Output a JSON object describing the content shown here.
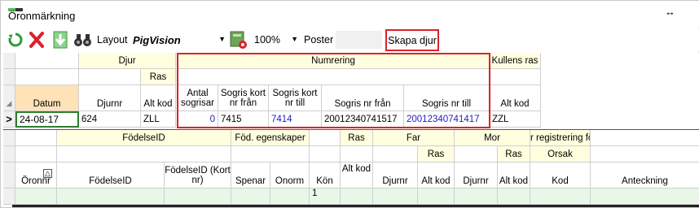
{
  "window": {
    "title": "Öronmärkning",
    "resize_icon": "↔"
  },
  "toolbar": {
    "layout_label": "Layout",
    "layout_value": "PigVision",
    "zoom_value": "100%",
    "poster_label": "Poster",
    "create_button": "Skapa djur"
  },
  "top_grid": {
    "groups": {
      "djur": "Djur",
      "ras": "Ras",
      "numrering": "Numrering",
      "kullens_ras": "Kullens ras"
    },
    "columns": {
      "datum": "Datum",
      "djurnr": "Djurnr",
      "alt_kod": "Alt kod",
      "antal_sogrisar": "Antal sogrisar",
      "sogris_kort_fran": "Sogris kort nr från",
      "sogris_kort_till": "Sogris kort nr till",
      "sogris_nr_fran": "Sogris nr från",
      "sogris_nr_till": "Sogris nr till",
      "kull_alt_kod": "Alt kod"
    },
    "row": {
      "indicator": ">",
      "datum": "24-08-17",
      "djurnr": "624",
      "alt_kod": "ZLL",
      "antal_sogrisar": "0",
      "sogris_kort_fran": "7415",
      "sogris_kort_till": "7414",
      "sogris_nr_fran": "20012340741517",
      "sogris_nr_till": "20012340741417",
      "kull_alt_kod": "ZZL"
    }
  },
  "bottom_grid": {
    "groups": {
      "fodelseid": "FödelseID",
      "fod_egenskaper": "Föd. egenskaper",
      "ras": "Ras",
      "far": "Far",
      "far_ras": "Ras",
      "mor": "Mor",
      "mor_ras": "Ras",
      "registrering": "r registrering föd",
      "orsak": "Orsak"
    },
    "columns": {
      "oronnr": "Öronnr",
      "fodelseid": "FödelseID",
      "fodelseid_kort": "FödelseID (Kort nr)",
      "spenar": "Spenar",
      "onorm": "Onorm",
      "kon": "Kön",
      "alt_kod": "Alt kod",
      "far_djurnr": "Djurnr",
      "far_alt_kod": "Alt kod",
      "mor_djurnr": "Djurnr",
      "mor_alt_kod": "Alt kod",
      "kod": "Kod",
      "anteckning": "Anteckning"
    },
    "sort_icon": "△",
    "row": {
      "kon": "1"
    }
  }
}
